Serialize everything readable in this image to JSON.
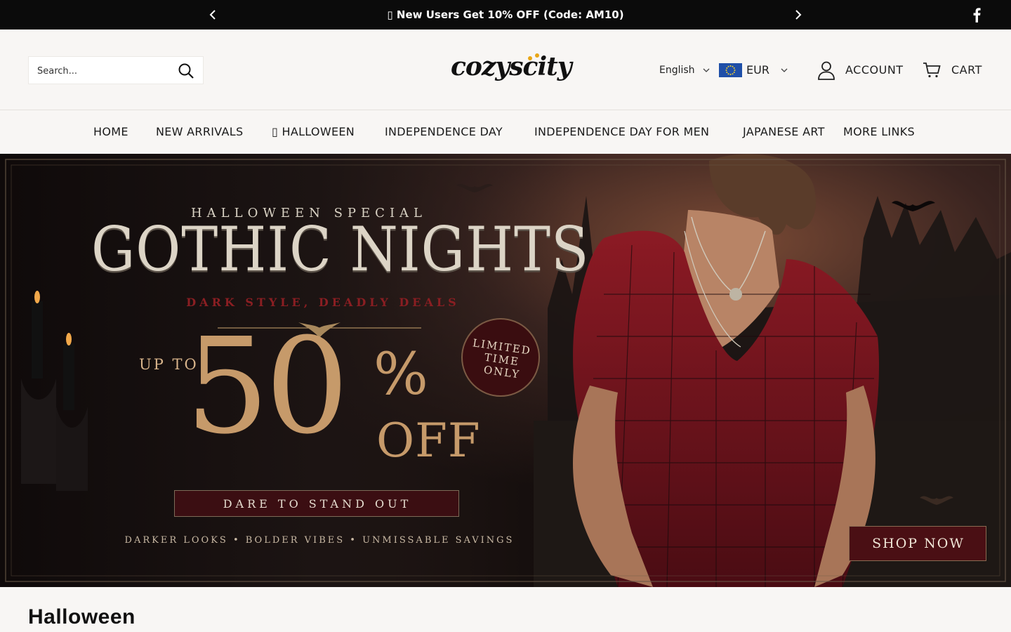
{
  "announcement": {
    "icon": "gift-emoji-glyph",
    "glyph": "▯",
    "text": "New Users Get 10% OFF (Code: AM10)"
  },
  "header": {
    "search_placeholder": "Search...",
    "logo_text": "cozyscity",
    "language": "English",
    "currency": "EUR",
    "account_label": "ACCOUNT",
    "cart_label": "CART"
  },
  "nav": {
    "items": [
      {
        "label": "HOME"
      },
      {
        "label": "NEW ARRIVALS"
      },
      {
        "label": "▯ HALLOWEEN"
      },
      {
        "label": "INDEPENDENCE DAY"
      },
      {
        "label": "INDEPENDENCE DAY FOR MEN"
      },
      {
        "label": "JAPANESE ART"
      },
      {
        "label": "MORE LINKS"
      }
    ]
  },
  "hero": {
    "eyebrow": "HALLOWEEN SPECIAL",
    "title": "GOTHIC NIGHTS",
    "subtitle": "DARK STYLE, DEADLY DEALS",
    "up_to": "UP TO",
    "discount": "50",
    "percent": "%",
    "off": "OFF",
    "badge_lines": [
      "LIMITED",
      "TIME",
      "ONLY"
    ],
    "dare": "DARE TO STAND OUT",
    "tagline": "DARKER LOOKS • BOLDER VIBES • UNMISSABLE SAVINGS",
    "cta": "SHOP NOW"
  },
  "section": {
    "title": "Halloween"
  },
  "colors": {
    "announce_bg": "#0b0b0b",
    "page_bg": "#f8f6f4",
    "hero_gold": "#c69a6a",
    "hero_red": "#8a1e22",
    "cta_bg": "#4a0f14"
  }
}
